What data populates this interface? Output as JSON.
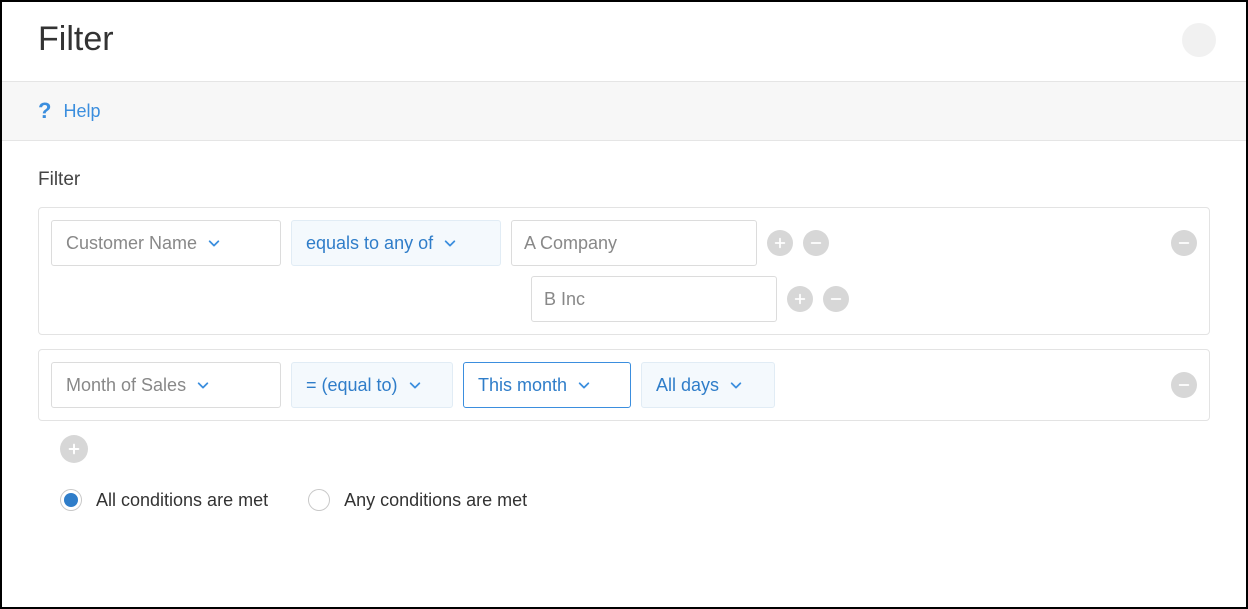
{
  "dialog": {
    "title": "Filter"
  },
  "help": {
    "label": "Help"
  },
  "section": {
    "label": "Filter"
  },
  "rows": [
    {
      "field": "Customer Name",
      "operator": "equals to any of",
      "values": [
        "A Company",
        "B Inc"
      ]
    },
    {
      "field": "Month of Sales",
      "operator": "= (equal to)",
      "value1": "This month",
      "value2": "All days"
    }
  ],
  "logic": {
    "all_label": "All conditions are met",
    "any_label": "Any conditions are met",
    "selected": "all"
  }
}
